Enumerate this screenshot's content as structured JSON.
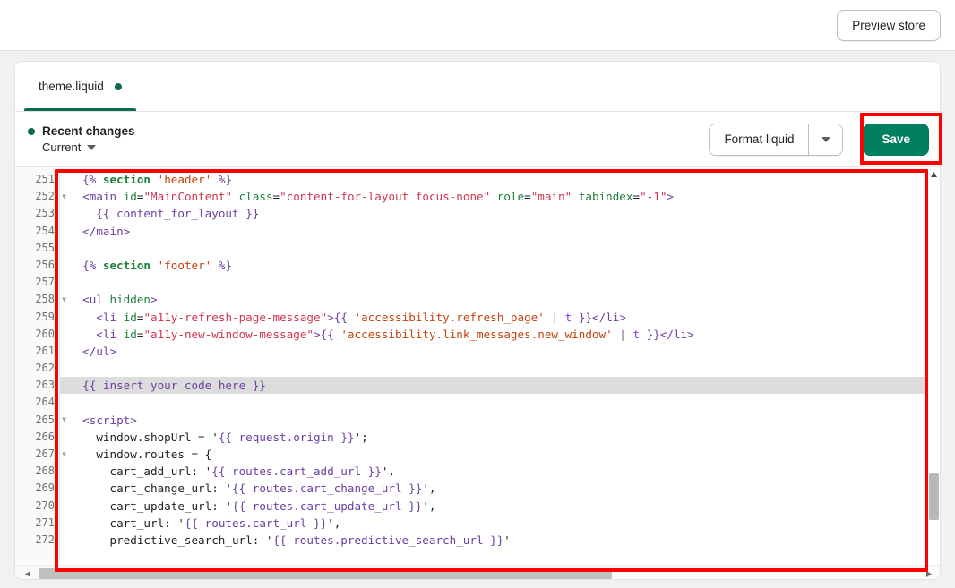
{
  "topbar": {
    "preview_store_label": "Preview store"
  },
  "editor": {
    "tabs": [
      {
        "label": "theme.liquid",
        "unsaved_dot": true,
        "active": true
      }
    ],
    "toolbar": {
      "recent_changes_label": "Recent changes",
      "version_label": "Current",
      "format_liquid_label": "Format liquid",
      "format_liquid_caret": "chevron-down-icon",
      "save_label": "Save",
      "save_color": "#008060",
      "accent_color": "#0f6a4c"
    },
    "annotations": {
      "color": "#ff0000",
      "boxes": [
        "save-button",
        "code-editor"
      ]
    },
    "code": {
      "first_line_number": 251,
      "active_line_number": 263,
      "fold_line_numbers": [
        252,
        258,
        265,
        267
      ],
      "lines": [
        {
          "n": 251,
          "text": "  {% section 'header' %}"
        },
        {
          "n": 252,
          "text": "  <main id=\"MainContent\" class=\"content-for-layout focus-none\" role=\"main\" tabindex=\"-1\">"
        },
        {
          "n": 253,
          "text": "    {{ content_for_layout }}"
        },
        {
          "n": 254,
          "text": "  </main>"
        },
        {
          "n": 255,
          "text": ""
        },
        {
          "n": 256,
          "text": "  {% section 'footer' %}"
        },
        {
          "n": 257,
          "text": ""
        },
        {
          "n": 258,
          "text": "  <ul hidden>"
        },
        {
          "n": 259,
          "text": "    <li id=\"a11y-refresh-page-message\">{{ 'accessibility.refresh_page' | t }}</li>"
        },
        {
          "n": 260,
          "text": "    <li id=\"a11y-new-window-message\">{{ 'accessibility.link_messages.new_window' | t }}</li>"
        },
        {
          "n": 261,
          "text": "  </ul>"
        },
        {
          "n": 262,
          "text": ""
        },
        {
          "n": 263,
          "text": "  {{ insert your code here }}"
        },
        {
          "n": 264,
          "text": ""
        },
        {
          "n": 265,
          "text": "  <script>"
        },
        {
          "n": 266,
          "text": "    window.shopUrl = '{{ request.origin }}';"
        },
        {
          "n": 267,
          "text": "    window.routes = {"
        },
        {
          "n": 268,
          "text": "      cart_add_url: '{{ routes.cart_add_url }}',"
        },
        {
          "n": 269,
          "text": "      cart_change_url: '{{ routes.cart_change_url }}',"
        },
        {
          "n": 270,
          "text": "      cart_update_url: '{{ routes.cart_update_url }}',"
        },
        {
          "n": 271,
          "text": "      cart_url: '{{ routes.cart_url }}',"
        },
        {
          "n": 272,
          "text": "      predictive_search_url: '{{ routes.predictive_search_url }}'"
        }
      ]
    }
  }
}
